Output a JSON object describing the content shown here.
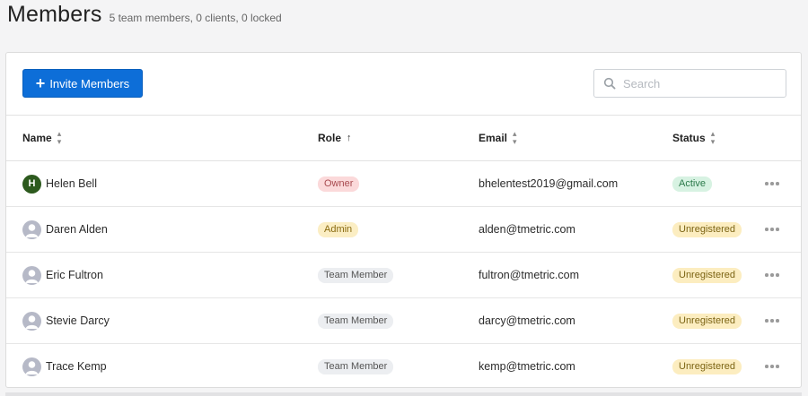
{
  "header": {
    "title": "Members",
    "subtitle": "5 team members, 0 clients, 0 locked"
  },
  "toolbar": {
    "invite_label": "Invite Members",
    "search_placeholder": "Search"
  },
  "columns": [
    {
      "label": "Name",
      "sort": "none"
    },
    {
      "label": "Role",
      "sort": "asc"
    },
    {
      "label": "Email",
      "sort": "none"
    },
    {
      "label": "Status",
      "sort": "none"
    }
  ],
  "rows": [
    {
      "name": "Helen Bell",
      "avatar": "H",
      "role": "Owner",
      "email": "bhelentest2019@gmail.com",
      "status": "Active"
    },
    {
      "name": "Daren Alden",
      "avatar": "",
      "role": "Admin",
      "email": "alden@tmetric.com",
      "status": "Unregistered"
    },
    {
      "name": "Eric Fultron",
      "avatar": "",
      "role": "Team Member",
      "email": "fultron@tmetric.com",
      "status": "Unregistered"
    },
    {
      "name": "Stevie Darcy",
      "avatar": "",
      "role": "Team Member",
      "email": "darcy@tmetric.com",
      "status": "Unregistered"
    },
    {
      "name": "Trace Kemp",
      "avatar": "",
      "role": "Team Member",
      "email": "kemp@tmetric.com",
      "status": "Unregistered"
    }
  ],
  "colors": {
    "primary": "#0d6ed8",
    "owner_badge": "#fbd9da",
    "admin_badge": "#fbeec4",
    "member_badge": "#eceef1",
    "active_badge": "#d7f2e2",
    "unregistered_badge": "#fcedc0",
    "avatar_initial": "#2d5a1e",
    "avatar_generic": "#b6b9c7"
  },
  "icons": {
    "invite": "plus-icon",
    "search": "search-icon",
    "sort": "sort-icon",
    "sort_asc": "arrow-up-icon",
    "avatar_placeholder": "user-icon",
    "row_menu": "more-horizontal-icon"
  }
}
